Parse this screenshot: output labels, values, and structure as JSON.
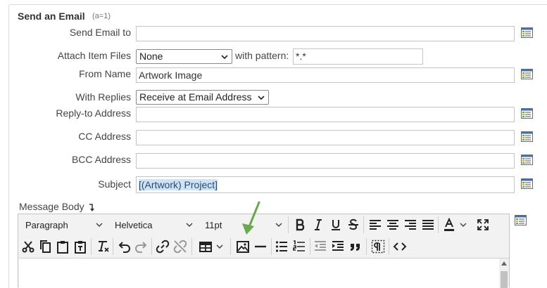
{
  "section": {
    "title": "Send an Email",
    "subtitle": "(a=1)"
  },
  "fields": {
    "send_email_to": {
      "label": "Send Email to",
      "value": ""
    },
    "attach_item_files": {
      "label": "Attach Item Files",
      "value": "None",
      "pattern_label": "with pattern:",
      "pattern_value": "*.*"
    },
    "from_name": {
      "label": "From Name",
      "value": "Artwork Image"
    },
    "with_replies": {
      "label": "With Replies",
      "value": "Receive at Email Address"
    },
    "reply_to": {
      "label": "Reply-to Address",
      "value": ""
    },
    "cc": {
      "label": "CC Address",
      "value": ""
    },
    "bcc": {
      "label": "BCC Address",
      "value": ""
    },
    "subject": {
      "label": "Subject",
      "value": "[(Artwork) Project]"
    }
  },
  "message_body": {
    "label": "Message Body",
    "toolbar": {
      "format": "Paragraph",
      "font": "Helvetica",
      "size": "11pt",
      "row1_icons": [
        "bold-icon",
        "italic-icon",
        "underline-icon",
        "strikethrough-icon",
        "align-left-icon",
        "align-center-icon",
        "align-right-icon",
        "align-justify-icon",
        "text-color-icon",
        "fullscreen-icon"
      ],
      "row2_icons": [
        "cut-icon",
        "copy-icon",
        "paste-icon",
        "paste-text-icon",
        "clear-format-icon",
        "undo-icon",
        "redo-icon",
        "link-icon",
        "unlink-icon",
        "table-icon",
        "image-icon",
        "horizontal-rule-icon",
        "bullet-list-icon",
        "numbered-list-icon",
        "outdent-icon",
        "indent-icon",
        "blockquote-icon",
        "show-blocks-icon",
        "source-code-icon"
      ]
    }
  },
  "colors": {
    "annotation_arrow": "#6aa84f",
    "field_border": "#c4c4c4",
    "highlight": "#cfe3f7"
  }
}
